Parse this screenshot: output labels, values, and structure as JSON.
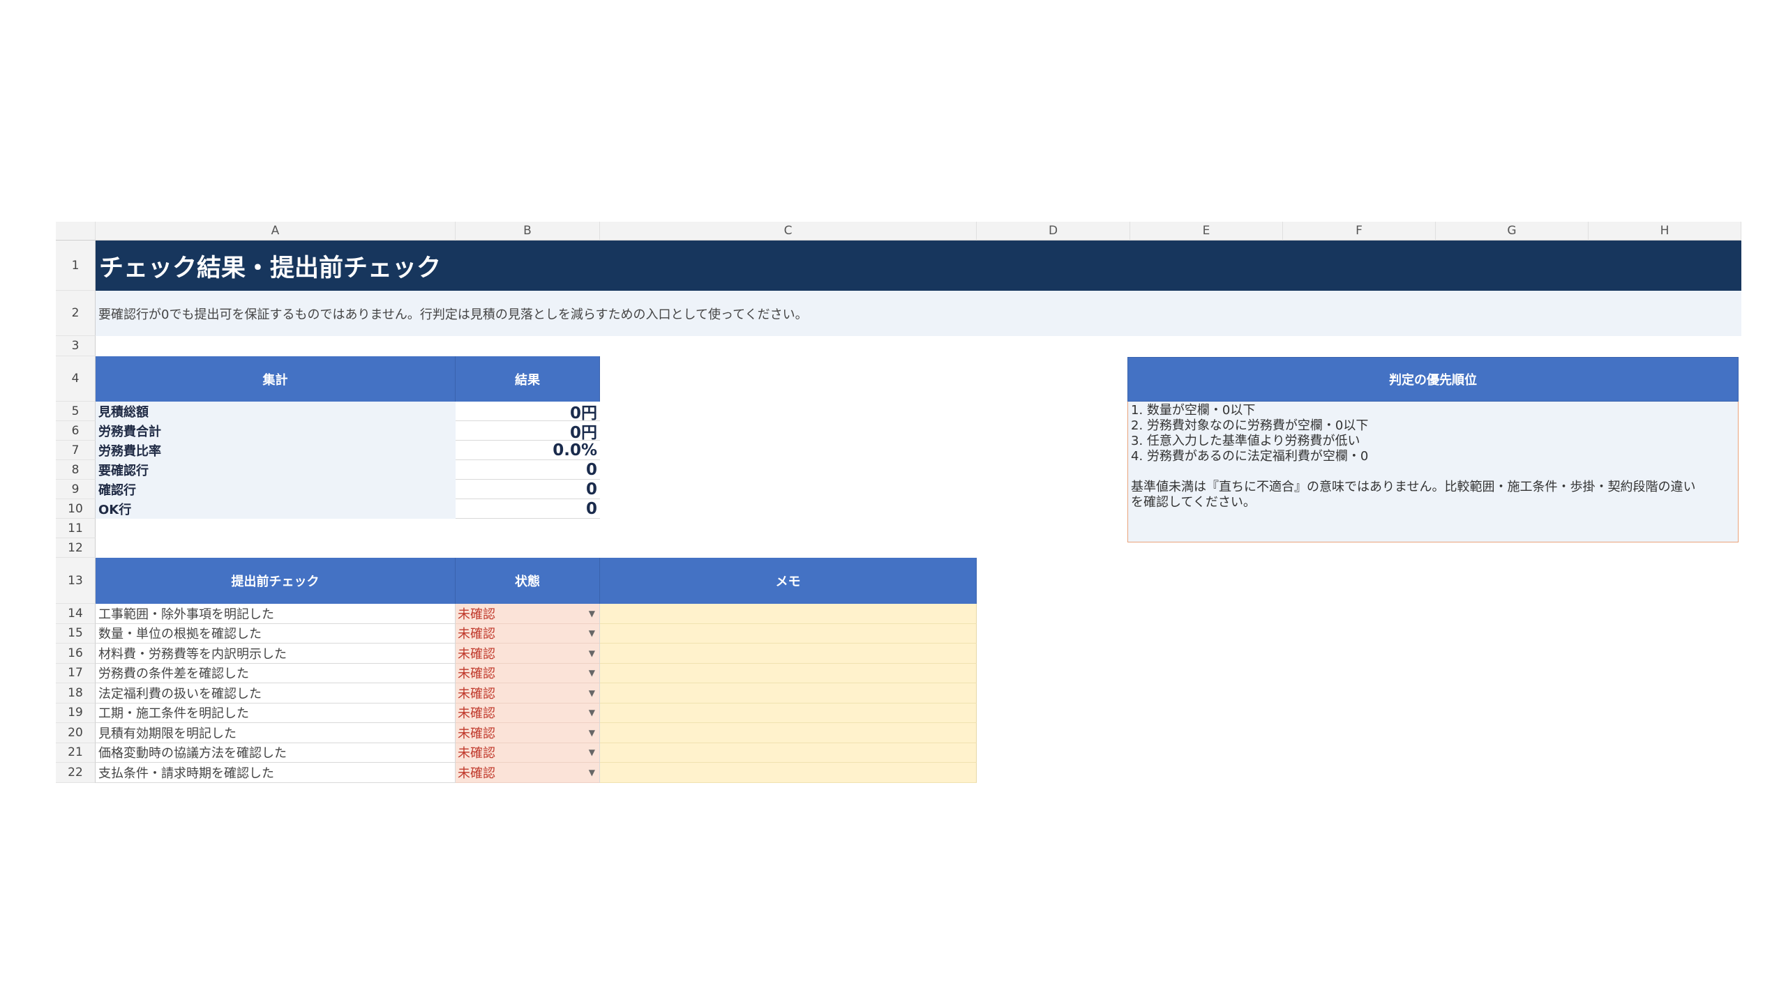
{
  "columns": [
    "A",
    "B",
    "C",
    "D",
    "E",
    "F",
    "G",
    "H"
  ],
  "title": "チェック結果・提出前チェック",
  "note": "要確認行が0でも提出可を保証するものではありません。行判定は見積の見落としを減らすための入口として使ってください。",
  "summary": {
    "header_label": "集計",
    "header_result": "結果",
    "rows": [
      {
        "label": "見積総額",
        "value": "0円"
      },
      {
        "label": "労務費合計",
        "value": "0円"
      },
      {
        "label": "労務費比率",
        "value": "0.0%"
      },
      {
        "label": "要確認行",
        "value": "0"
      },
      {
        "label": "確認行",
        "value": "0"
      },
      {
        "label": "OK行",
        "value": "0"
      }
    ]
  },
  "checklist": {
    "header_item": "提出前チェック",
    "header_status": "状態",
    "header_memo": "メモ",
    "items": [
      {
        "label": "工事範囲・除外事項を明記した",
        "status": "未確認"
      },
      {
        "label": "数量・単位の根拠を確認した",
        "status": "未確認"
      },
      {
        "label": "材料費・労務費等を内訳明示した",
        "status": "未確認"
      },
      {
        "label": "労務費の条件差を確認した",
        "status": "未確認"
      },
      {
        "label": "法定福利費の扱いを確認した",
        "status": "未確認"
      },
      {
        "label": "工期・施工条件を明記した",
        "status": "未確認"
      },
      {
        "label": "見積有効期限を明記した",
        "status": "未確認"
      },
      {
        "label": "価格変動時の協議方法を確認した",
        "status": "未確認"
      },
      {
        "label": "支払条件・請求時期を確認した",
        "status": "未確認"
      }
    ]
  },
  "priority": {
    "title": "判定の優先順位",
    "body": "1. 数量が空欄・0以下\n2. 労務費対象なのに労務費が空欄・0以下\n3. 任意入力した基準値より労務費が低い\n4. 労務費があるのに法定福利費が空欄・0\n\n基準値未満は『直ちに不適合』の意味ではありません。比較範囲・施工条件・歩掛・契約段階の違い\nを確認してください。"
  },
  "colors": {
    "title_bg": "#17365d",
    "header_bg": "#4472c4",
    "status_bg": "#fbe3d8",
    "status_text": "#c0392b",
    "memo_bg": "#fff2cc"
  }
}
